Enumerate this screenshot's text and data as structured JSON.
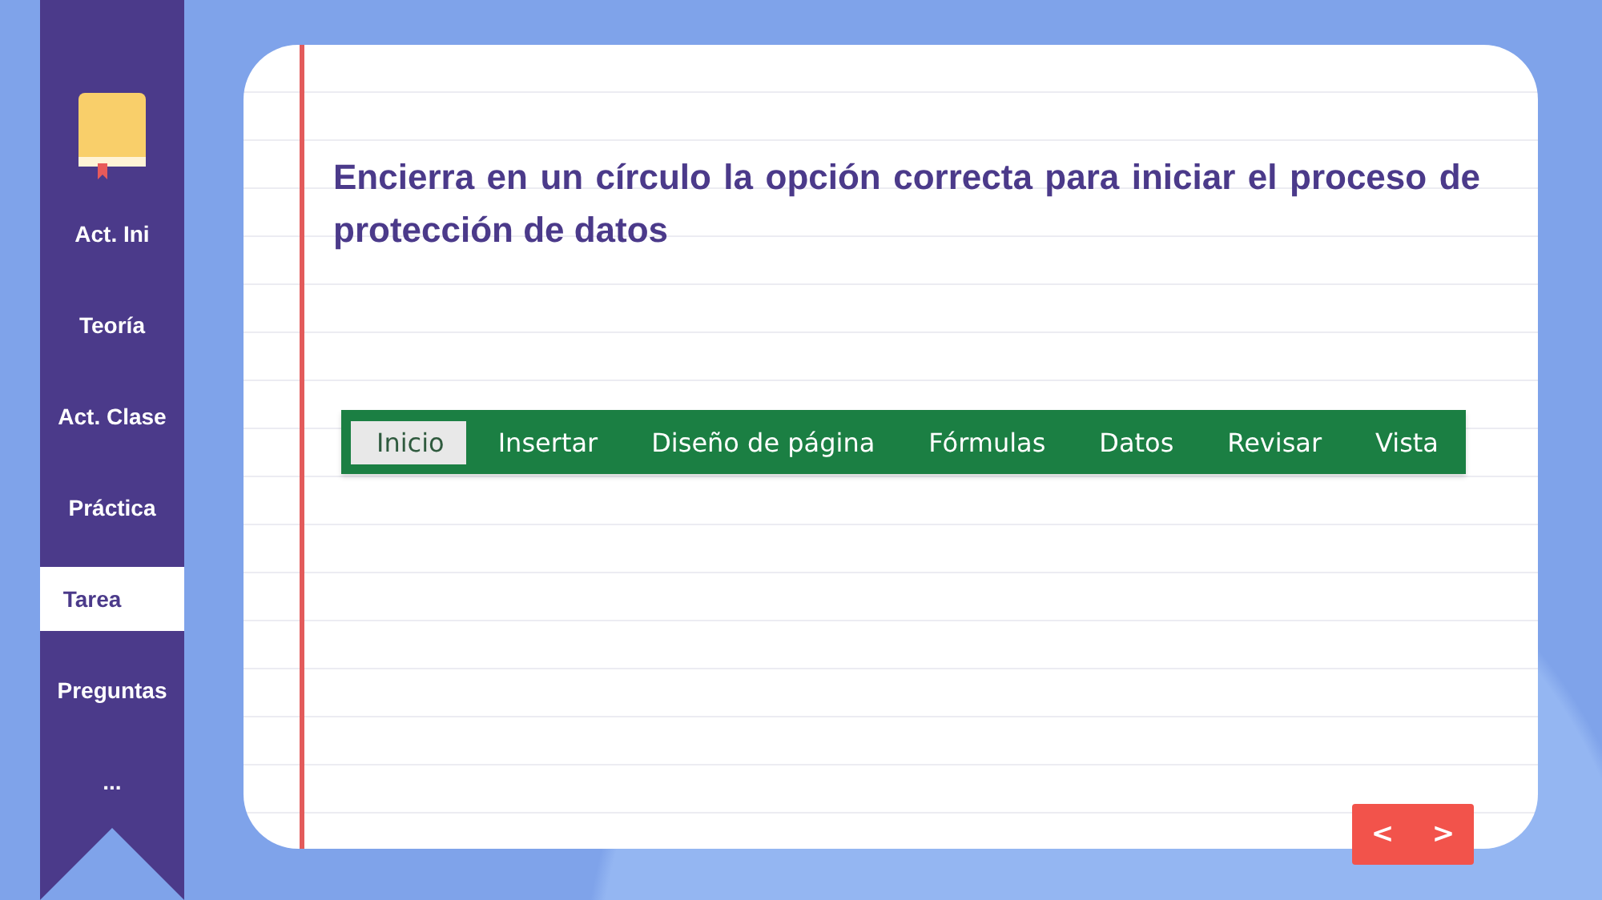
{
  "sidebar": {
    "items": [
      {
        "label": "Act. Ini",
        "selected": false
      },
      {
        "label": "Teoría",
        "selected": false
      },
      {
        "label": "Act. Clase",
        "selected": false
      },
      {
        "label": "Práctica",
        "selected": false
      },
      {
        "label": "Tarea",
        "selected": true
      },
      {
        "label": "Preguntas",
        "selected": false
      },
      {
        "label": "...",
        "selected": false
      }
    ]
  },
  "question": "Encierra en un círculo la opción correcta para iniciar el proceso de protección de datos",
  "ribbon": {
    "tabs": [
      {
        "label": "Inicio",
        "selected": true
      },
      {
        "label": "Insertar",
        "selected": false
      },
      {
        "label": "Diseño de página",
        "selected": false
      },
      {
        "label": "Fórmulas",
        "selected": false
      },
      {
        "label": "Datos",
        "selected": false
      },
      {
        "label": "Revisar",
        "selected": false
      },
      {
        "label": "Vista",
        "selected": false
      }
    ]
  },
  "navigation": {
    "previous": "<",
    "next": ">"
  }
}
